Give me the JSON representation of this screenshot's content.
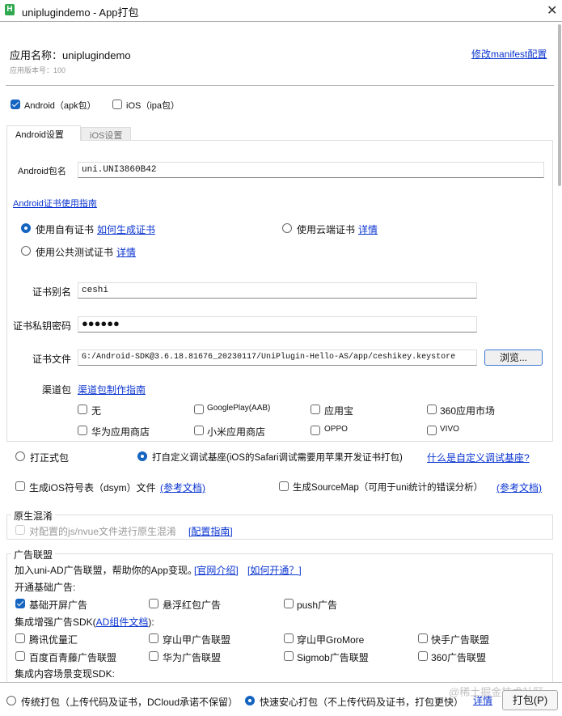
{
  "window": {
    "title": "uniplugindemo - App打包",
    "icon_letter": "H",
    "close": "✕"
  },
  "app": {
    "name_label": "应用名称：uniplugindemo",
    "version": "应用版本号：100",
    "manifest_link": "修改manifest配置"
  },
  "platforms": [
    {
      "label": "Android（apk包）",
      "checked": true
    },
    {
      "label": "iOS（ipa包）",
      "checked": false
    }
  ],
  "tabs": [
    {
      "label": "Android设置",
      "active": true
    },
    {
      "label": "iOS设置",
      "active": false
    }
  ],
  "android": {
    "package_label": "Android包名",
    "package_value": "uni.UNI3860B42",
    "cert_guide_link": "Android证书使用指南",
    "cert_options": [
      {
        "label": "使用自有证书",
        "link": "如何生成证书",
        "selected": true
      },
      {
        "label": "使用云端证书",
        "link": "详情",
        "selected": false
      },
      {
        "label": "使用公共测试证书",
        "link": "详情",
        "selected": false
      }
    ],
    "alias_label": "证书别名",
    "alias_value": "ceshi",
    "password_label": "证书私钥密码",
    "password_value": "●●●●●●",
    "file_label": "证书文件",
    "file_value": "G:/Android-SDK@3.6.18.81676_20230117/UniPlugin-Hello-AS/app/ceshikey.keystore",
    "browse_button": "浏览...",
    "channel_label": "渠道包",
    "channel_link": "渠道包制作指南",
    "channels": [
      "无",
      "GooglePlay(AAB)",
      "应用宝",
      "360应用市场",
      "华为应用商店",
      "小米应用商店",
      "OPPO",
      "VIVO"
    ]
  },
  "build_type": {
    "options": [
      {
        "label": "打正式包",
        "selected": false
      },
      {
        "label": "打自定义调试基座(iOS的Safari调试需要用苹果开发证书打包)",
        "selected": true
      }
    ],
    "link": "什么是自定义调试基座?"
  },
  "extras": [
    {
      "label": "生成iOS符号表（dsym）文件",
      "link": "(参考文档)"
    },
    {
      "label": "生成SourceMap（可用于uni统计的错误分析）",
      "link": "(参考文档)"
    }
  ],
  "obfuscation": {
    "legend": "原生混淆",
    "checkbox": "对配置的js/nvue文件进行原生混淆",
    "link": "[配置指南]"
  },
  "ads": {
    "legend": "广告联盟",
    "intro": "加入uni-AD广告联盟，帮助你的App变现。",
    "intro_link1": "[官网介绍]",
    "intro_link2": "[如何开通？]",
    "basic_title": "开通基础广告:",
    "basic": [
      {
        "label": "基础开屏广告",
        "checked": true
      },
      {
        "label": "悬浮红包广告",
        "checked": false
      },
      {
        "label": "push广告",
        "checked": false
      }
    ],
    "enhanced_title_pre": "集成增强广告SDK(",
    "enhanced_link": "AD组件文档",
    "enhanced_title_post": "):",
    "enhanced": [
      "腾讯优量汇",
      "穿山甲广告联盟",
      "穿山甲GroMore",
      "快手广告联盟",
      "百度百青藤广告联盟",
      "华为广告联盟",
      "Sigmob广告联盟",
      "360广告联盟"
    ],
    "content_title": "集成内容场景变现SDK:"
  },
  "footer": {
    "options": [
      {
        "label": "传统打包（上传代码及证书，DCloud承诺不保留）",
        "selected": false
      },
      {
        "label": "快速安心打包（不上传代码及证书，打包更快）",
        "selected": true
      }
    ],
    "link": "详情",
    "pack_button": "打包(P)",
    "watermark": "@稀土掘金技术社区"
  }
}
